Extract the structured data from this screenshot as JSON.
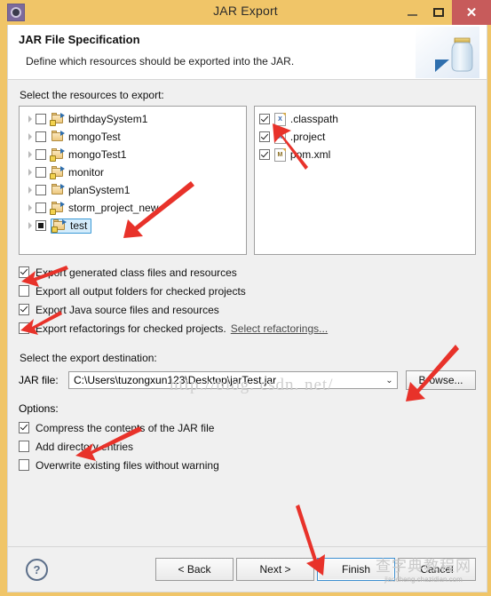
{
  "window": {
    "title": "JAR Export",
    "icon": "eclipse-icon",
    "buttons": {
      "minimize": "–",
      "maximize": "▢",
      "close": "✕"
    }
  },
  "header": {
    "title": "JAR File Specification",
    "subtitle": "Define which resources should be exported into the JAR.",
    "image": "jar-jar-icon"
  },
  "resources": {
    "label": "Select the resources to export:",
    "left_items": [
      {
        "name": "birthdaySystem1",
        "checked": "unchecked",
        "selected": false,
        "expandable": true
      },
      {
        "name": "mongoTest",
        "checked": "unchecked",
        "selected": false,
        "expandable": true
      },
      {
        "name": "mongoTest1",
        "checked": "unchecked",
        "selected": false,
        "expandable": true
      },
      {
        "name": "monitor",
        "checked": "unchecked",
        "selected": false,
        "expandable": true
      },
      {
        "name": "planSystem1",
        "checked": "unchecked",
        "selected": false,
        "expandable": true
      },
      {
        "name": "storm_project_new",
        "checked": "unchecked",
        "selected": false,
        "expandable": true
      },
      {
        "name": "test",
        "checked": "partial",
        "selected": true,
        "expandable": true
      }
    ],
    "right_items": [
      {
        "name": ".classpath",
        "checked": "checked",
        "icon": "X"
      },
      {
        "name": ".project",
        "checked": "checked",
        "icon": "X"
      },
      {
        "name": "pom.xml",
        "checked": "checked",
        "icon": "M"
      }
    ]
  },
  "export_options": [
    {
      "label": "Export generated class files and resources",
      "checked": true,
      "link": ""
    },
    {
      "label": "Export all output folders for checked projects",
      "checked": false,
      "link": ""
    },
    {
      "label": "Export Java source files and resources",
      "checked": true,
      "link": ""
    },
    {
      "label": "Export refactorings for checked projects.",
      "checked": false,
      "link": "Select refactorings..."
    }
  ],
  "destination": {
    "label": "Select the export destination:",
    "field_label": "JAR file:",
    "value": "C:\\Users\\tuzongxun123\\Desktop\\jarTest.jar",
    "browse_label": "Browse..."
  },
  "options": {
    "label": "Options:",
    "items": [
      {
        "label": "Compress the contents of the JAR file",
        "checked": true
      },
      {
        "label": "Add directory entries",
        "checked": false
      },
      {
        "label": "Overwrite existing files without warning",
        "checked": false
      }
    ]
  },
  "footer": {
    "help": "?",
    "back_label": "< Back",
    "next_label": "Next >",
    "finish_label": "Finish",
    "cancel_label": "Cancel"
  },
  "watermarks": {
    "csdn": "http://blog. csdn. net/",
    "cn_big": "查字典教程网",
    "cn_small": "jiaocheng.chazidian.com"
  },
  "colors": {
    "titlebar": "#f0c568",
    "close": "#c75b5b",
    "selection": "#d4ecfb",
    "annotation": "#e8322a",
    "default_button_border": "#3c8fd0"
  }
}
